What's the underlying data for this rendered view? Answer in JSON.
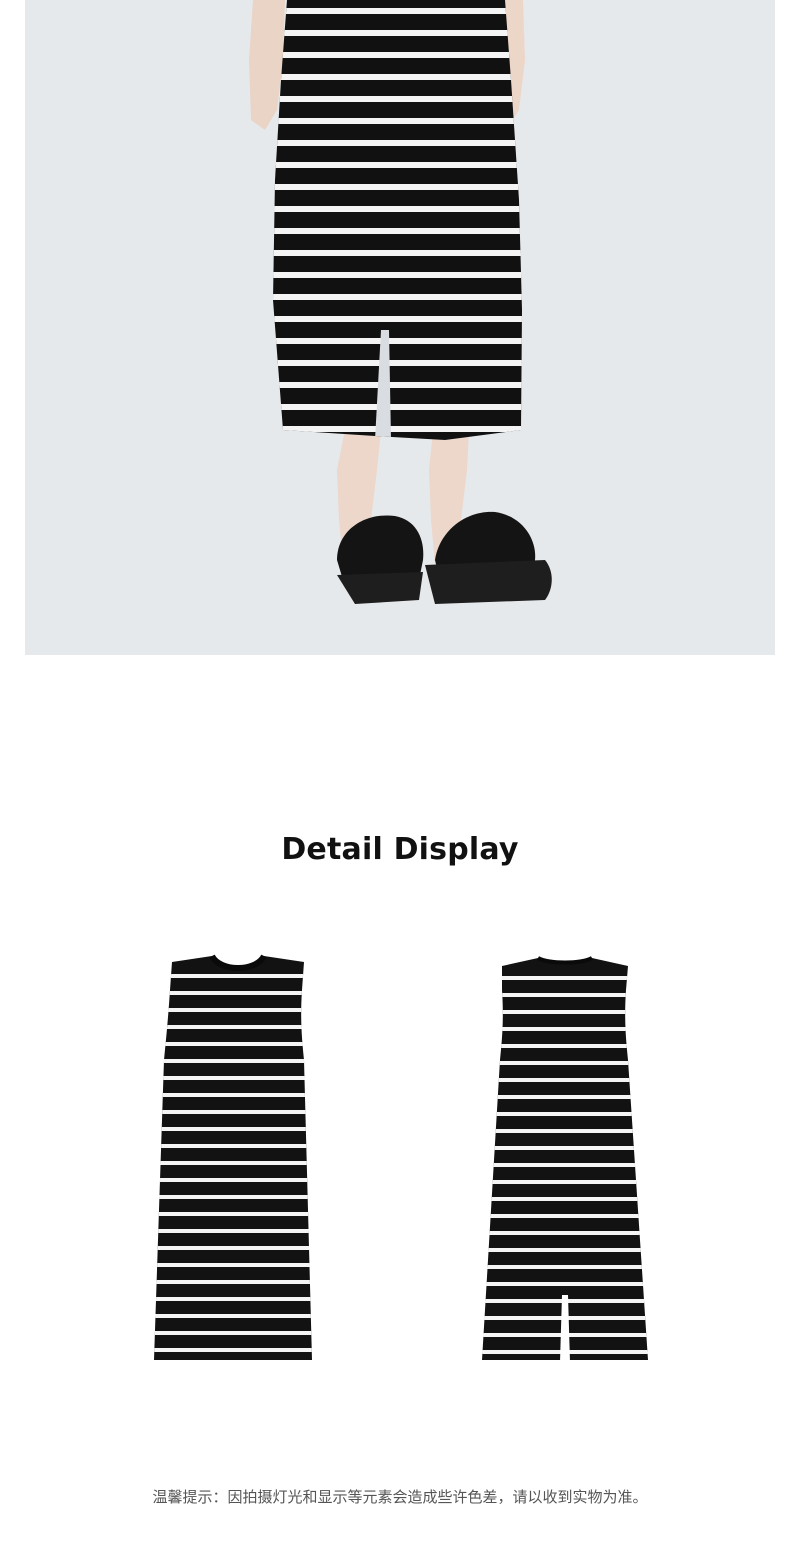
{
  "hero_photo": {
    "subject": "model wearing black and white striped sleeveless knit dress, back view with rear slit, black platform slide sandals",
    "background_color": "#e6e9ec",
    "stripe_color_dark": "#111111",
    "stripe_color_light": "#ffffff"
  },
  "detail": {
    "title": "Detail Display",
    "front_image": {
      "view": "front",
      "neck": "crew neck",
      "sleeves": "sleeveless"
    },
    "back_image": {
      "view": "back",
      "feature": "center back slit"
    }
  },
  "footer": {
    "notice": "温馨提示：因拍摄灯光和显示等元素会造成些许色差，请以收到实物为准。"
  },
  "colors": {
    "title": "#111111",
    "notice": "#555555",
    "page_background": "#ffffff"
  }
}
